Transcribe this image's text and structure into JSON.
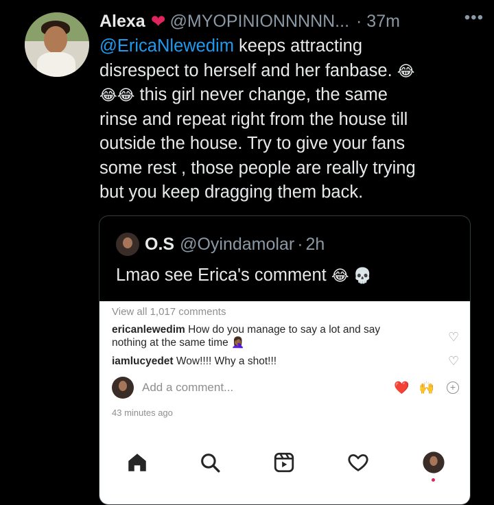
{
  "tweet": {
    "author_name": "Alexa",
    "handle": "@MYOPINIONNNNN...",
    "time": "37m",
    "more": "•••",
    "lines": [
      {
        "mention": "@EricaNlewedim",
        "text": " keeps attracting"
      },
      {
        "text": "disrespect to herself and her fanbase. ",
        "emoji_after": "😂"
      },
      {
        "emoji_before": "😂😂",
        "text": " this girl never change, the same"
      },
      {
        "text": "rinse and repeat right from the house till"
      },
      {
        "text": "outside the house. Try to give your fans"
      },
      {
        "text": "some rest , those people are really trying"
      },
      {
        "text": "but you keep dragging them back."
      }
    ],
    "author_heart": "❤"
  },
  "quote": {
    "name": "O.S",
    "handle": "@Oyindamolar",
    "dot": "·",
    "time": "2h",
    "text": "Lmao see Erica's comment ",
    "emoji": "😂 💀"
  },
  "instagram": {
    "view_all": "View all 1,017 comments",
    "comments": [
      {
        "user": "ericanlewedim",
        "text": " How do you manage to say a lot and say nothing at the same time ",
        "emoji": "🤦🏾‍♀️"
      },
      {
        "user": "iamlucyedet",
        "text": " Wow!!!! Why a shot!!!"
      }
    ],
    "add_comment_placeholder": "Add a comment...",
    "quick_emojis": [
      "❤️",
      "🙌"
    ],
    "time_ago": "43 minutes ago"
  },
  "colors": {
    "mention": "#1d9bf0",
    "muted": "#8b98a5",
    "like": "#e0245e",
    "ig_muted": "#8e8e8e"
  }
}
